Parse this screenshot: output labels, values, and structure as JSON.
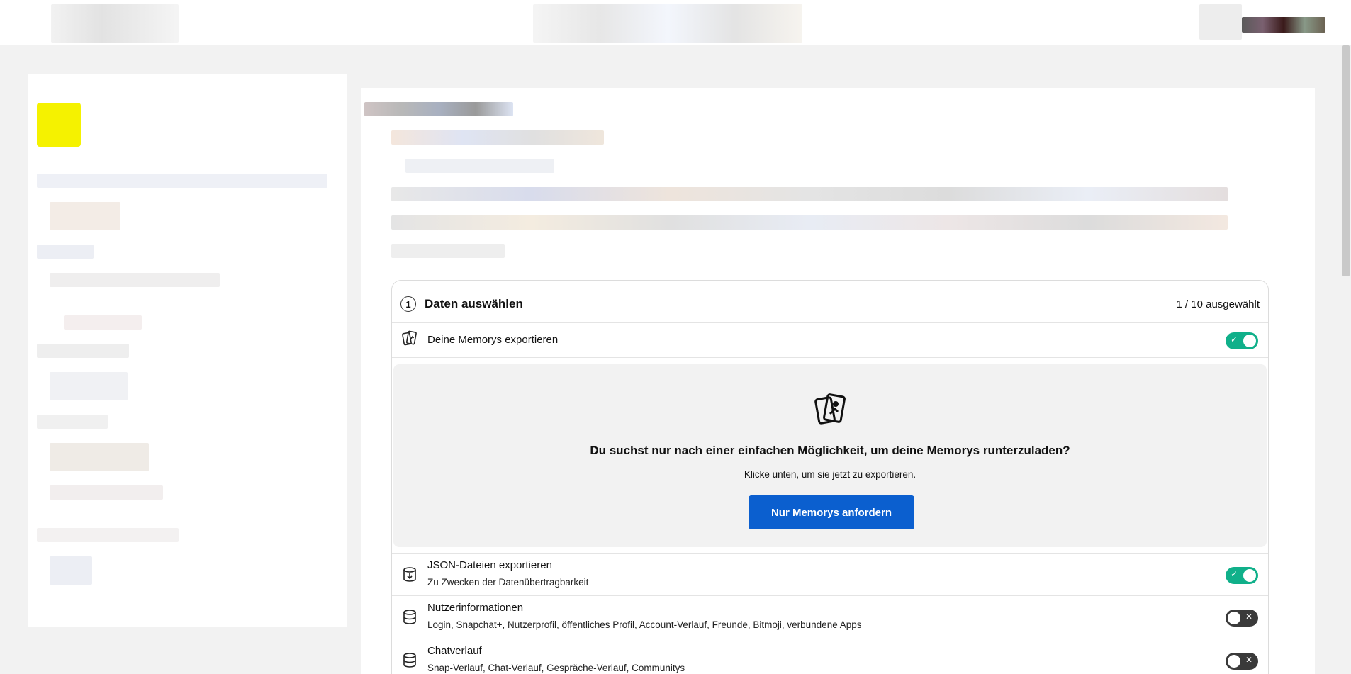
{
  "step": {
    "number": "1",
    "title": "Daten auswählen",
    "count": "1 / 10 ausgewählt"
  },
  "memories_row": {
    "label": "Deine Memorys exportieren",
    "toggle": "on"
  },
  "promo": {
    "title": "Du suchst nur nach einer einfachen Möglichkeit, um deine Memorys runterzuladen?",
    "text": "Klicke unten, um sie jetzt zu exportieren.",
    "button_label": "Nur Memorys anfordern"
  },
  "options": [
    {
      "title": "JSON-Dateien exportieren",
      "subtitle": "Zu Zwecken der Datenübertragbarkeit",
      "toggle": "on",
      "icon": "json-export-icon"
    },
    {
      "title": "Nutzerinformationen",
      "subtitle": "Login, Snapchat+, Nutzerprofil, öffentliches Profil, Account-Verlauf, Freunde, Bitmoji, verbundene Apps",
      "toggle": "off",
      "icon": "database-icon"
    },
    {
      "title": "Chatverlauf",
      "subtitle": "Snap-Verlauf, Chat-Verlauf, Gespräche-Verlauf, Communitys",
      "toggle": "off",
      "icon": "database-icon"
    }
  ],
  "toggle_marks": {
    "on": "✓",
    "off": "✕"
  },
  "colors": {
    "toggle_on": "#10b08a",
    "toggle_off": "#3a3a3a",
    "primary_button": "#0b5fcf",
    "logo": "#f5f200"
  }
}
